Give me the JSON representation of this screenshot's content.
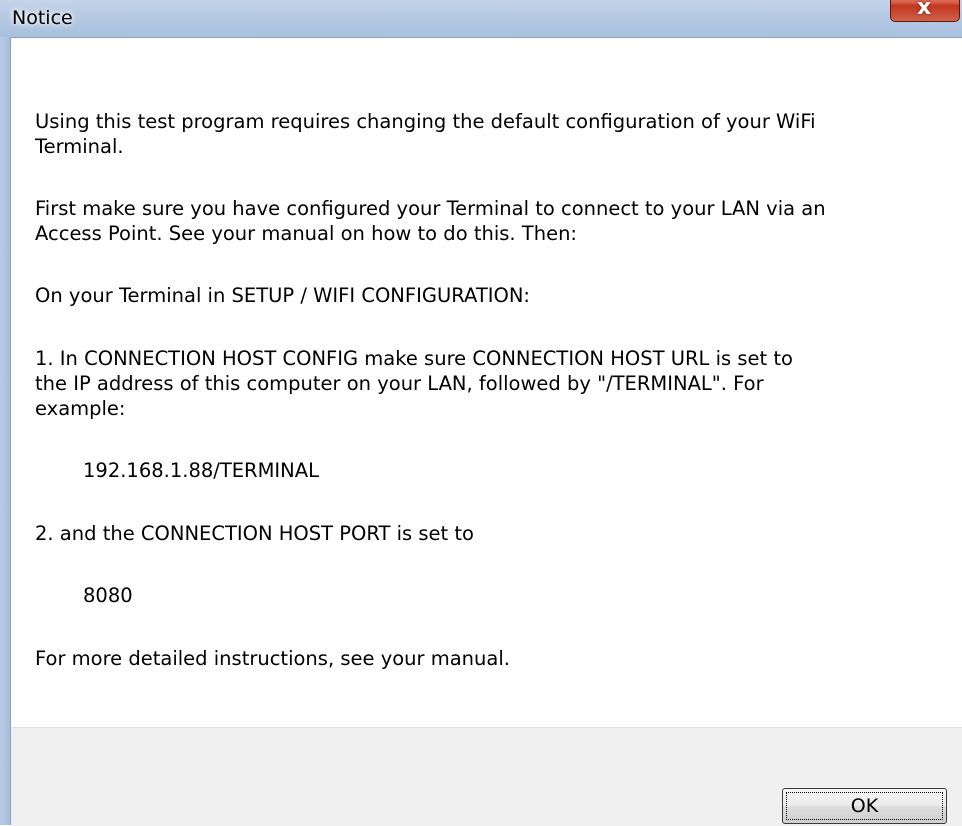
{
  "window": {
    "title": "Notice",
    "close_glyph": "x"
  },
  "message": {
    "intro": "Using this test program requires changing the default configuration of your WiFi",
    "intro_cont": "Terminal.",
    "first_line1": "First make sure you have configured your Terminal to connect to your LAN via an",
    "first_line2": "Access Point. See your manual on how to do this. Then:",
    "setup": "On your Terminal in SETUP / WIFI CONFIGURATION:",
    "step1_line1": "1. In CONNECTION HOST CONFIG make sure CONNECTION HOST URL is set to",
    "step1_line2": "the IP address of this computer on your LAN, followed by \"/TERMINAL\". For",
    "step1_line3": "example:",
    "example_url": "192.168.1.88/TERMINAL",
    "step2": "2. and the CONNECTION HOST PORT is set to",
    "example_port": "8080",
    "closing": "For more detailed instructions, see your manual."
  },
  "buttons": {
    "ok_label": "OK"
  },
  "icons": {
    "close": "close-icon"
  },
  "colors": {
    "titlebar": "#b5c9e3",
    "close_button": "#c2361f",
    "footer": "#f0f0f0"
  }
}
